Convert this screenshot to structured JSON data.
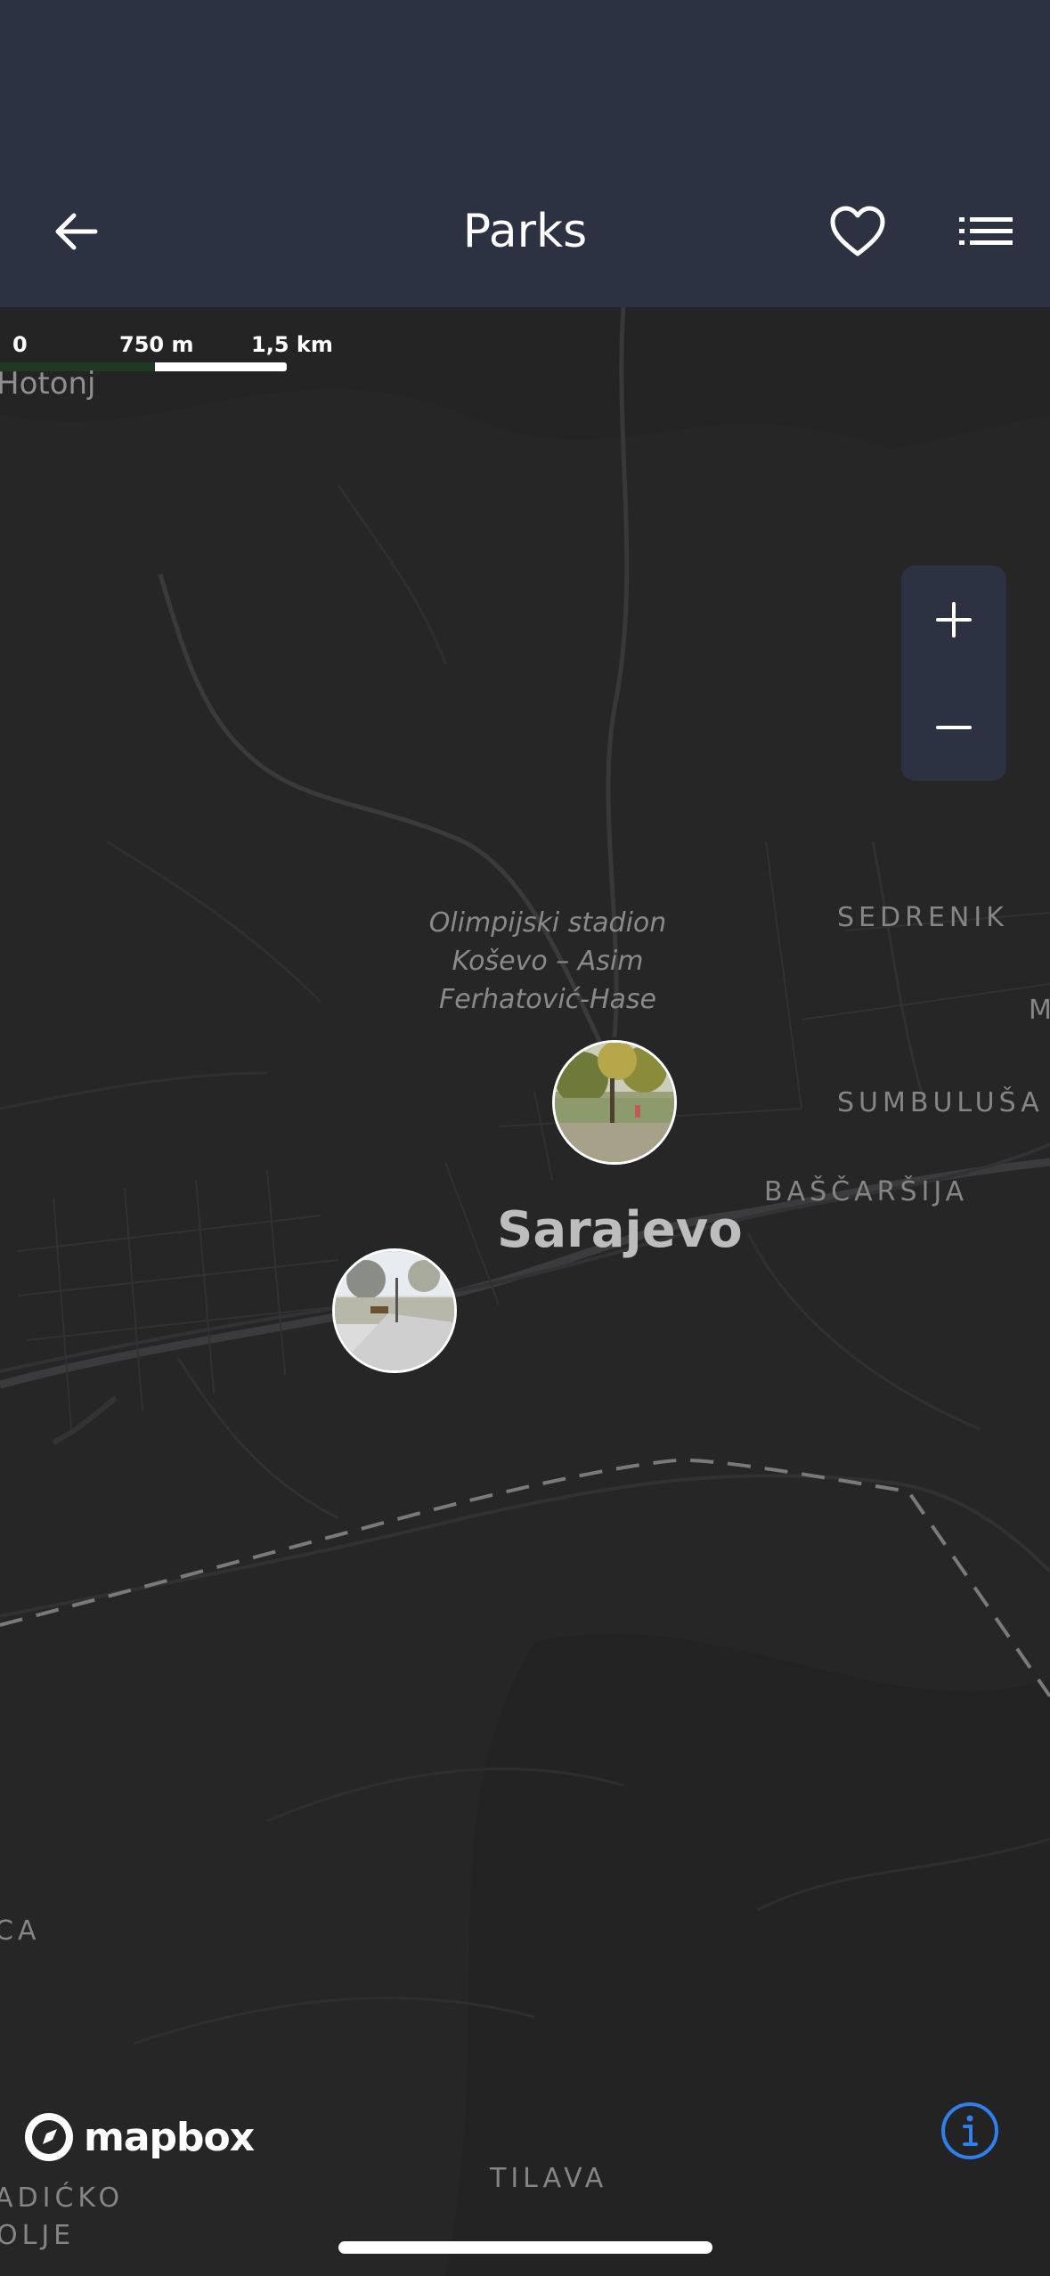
{
  "header": {
    "title": "Parks",
    "back_icon": "arrow-left-icon",
    "favorite_icon": "heart-outline-icon",
    "list_icon": "list-icon",
    "background": "#2c3241"
  },
  "map": {
    "scale": {
      "labels": [
        "0",
        "750 m",
        "1,5 km"
      ]
    },
    "labels": {
      "hotonj": "Hotonj",
      "stadium_line1": "Olimpijski stadion",
      "stadium_line2": "Koševo – Asim",
      "stadium_line3": "Ferhatović-Hase",
      "sedrenik": "SEDRENIK",
      "m_partial": "M",
      "sumbulusa": "SUMBULUŠA",
      "bascarsija": "BAŠČARŠIJA",
      "sarajevo": "Sarajevo",
      "ca_partial": "CA",
      "tilava": "TILAVA",
      "adicko": "ADIĆKO",
      "olje": "OLJE"
    },
    "zoom": {
      "zoom_in_icon": "plus-icon",
      "zoom_out_icon": "minus-icon"
    },
    "markers": [
      {
        "name": "park-marker-1",
        "icon": "park-photo-thumbnail"
      },
      {
        "name": "park-marker-2",
        "icon": "park-photo-thumbnail"
      }
    ],
    "attribution": {
      "logo_text": "mapbox",
      "info_icon": "info-icon",
      "info_color": "#2f80ed"
    }
  }
}
